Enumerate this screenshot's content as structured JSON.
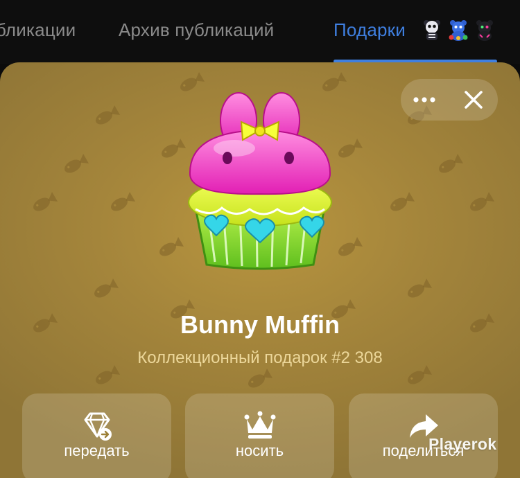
{
  "tabs": [
    {
      "label": "бликации",
      "active": false
    },
    {
      "label": "Архив публикаций",
      "active": false
    },
    {
      "label": "Подарки",
      "active": true
    }
  ],
  "tab_emoji_icons": [
    "skull-teddy-icon",
    "blue-teddy-icon",
    "dark-teddy-icon"
  ],
  "gift": {
    "name": "Bunny Muffin",
    "subtitle": "Коллекционный подарок #2 308"
  },
  "header_controls": {
    "more_icon": "ellipsis-icon",
    "close_icon": "close-icon"
  },
  "actions": [
    {
      "label": "передать",
      "icon": "diamond-transfer-icon"
    },
    {
      "label": "носить",
      "icon": "crown-icon"
    },
    {
      "label": "поделиться",
      "icon": "share-arrow-icon"
    }
  ],
  "watermark": "Playerok",
  "colors": {
    "active_tab": "#3f7fe0",
    "background": "#a4853b",
    "subtitle": "#ecd79a"
  }
}
